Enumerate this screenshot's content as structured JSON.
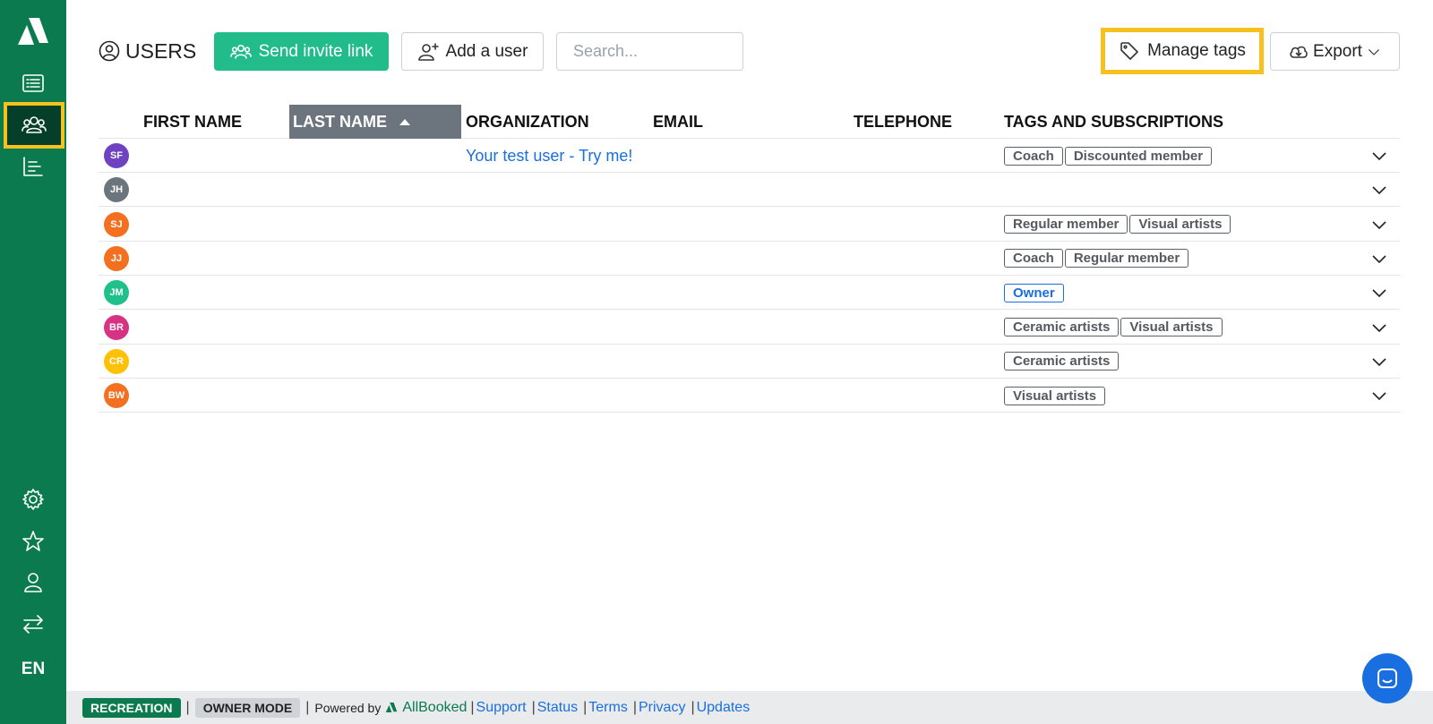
{
  "sidebar": {
    "language": "EN",
    "items": [
      {
        "name": "list-icon"
      },
      {
        "name": "users-icon"
      },
      {
        "name": "report-icon"
      },
      {
        "name": "gear-icon"
      },
      {
        "name": "star-icon"
      },
      {
        "name": "profile-icon"
      },
      {
        "name": "switch-icon"
      }
    ]
  },
  "header": {
    "title": "USERS",
    "send_invite_label": "Send invite link",
    "add_user_label": "Add a user",
    "search_placeholder": "Search...",
    "manage_tags_label": "Manage tags",
    "export_label": "Export"
  },
  "table": {
    "columns": [
      "FIRST NAME",
      "LAST NAME",
      "ORGANIZATION",
      "EMAIL",
      "TELEPHONE",
      "TAGS AND SUBSCRIPTIONS"
    ],
    "sorted_column": "LAST NAME",
    "rows": [
      {
        "initials": "SF",
        "color": "#6f42c1",
        "organization": "Your test user - Try me!",
        "tags": [
          "Coach",
          "Discounted member"
        ]
      },
      {
        "initials": "JH",
        "color": "#6c757d",
        "organization": "",
        "tags": []
      },
      {
        "initials": "SJ",
        "color": "#f37021",
        "organization": "",
        "tags": [
          "Regular member",
          "Visual artists"
        ]
      },
      {
        "initials": "JJ",
        "color": "#f37021",
        "organization": "",
        "tags": [
          "Coach",
          "Regular member"
        ]
      },
      {
        "initials": "JM",
        "color": "#20c08a",
        "organization": "",
        "tags": [
          "Owner"
        ]
      },
      {
        "initials": "BR",
        "color": "#d63384",
        "organization": "",
        "tags": [
          "Ceramic artists",
          "Visual artists"
        ]
      },
      {
        "initials": "CR",
        "color": "#ffc107",
        "organization": "",
        "tags": [
          "Ceramic artists"
        ]
      },
      {
        "initials": "BW",
        "color": "#f37021",
        "organization": "",
        "tags": [
          "Visual artists"
        ]
      }
    ]
  },
  "footer": {
    "recreation_badge": "RECREATION",
    "owner_mode_badge": "OWNER MODE",
    "powered_by": "Powered by",
    "brand": "AllBooked",
    "links": [
      "Support",
      "Status",
      "Terms",
      "Privacy",
      "Updates"
    ]
  },
  "colors": {
    "brand": "#0b7a4e",
    "accent": "#21bc89",
    "highlight": "#f4c11f",
    "link": "#1a6fe0"
  }
}
